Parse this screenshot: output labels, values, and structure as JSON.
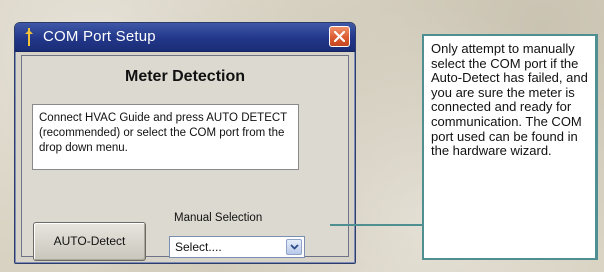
{
  "window": {
    "title": "COM Port Setup",
    "heading": "Meter Detection",
    "instructions": "Connect HVAC Guide and press AUTO DETECT (recommended) or select the COM port from the drop down menu.",
    "autodetect_label": "AUTO-Detect",
    "manual_label": "Manual Selection",
    "select_value": "Select...."
  },
  "callout": {
    "text": "Only attempt to manually select the COM port if the Auto-Detect has failed, and you are sure the meter is connected and ready for communication. The COM port used can be found in the hardware wizard."
  },
  "colors": {
    "titlebar": "#22378a",
    "close_button": "#d9582d",
    "callout_border": "#4f8f92"
  },
  "icons": {
    "title": "app-icon",
    "close": "close-icon",
    "dropdown": "chevron-down-icon"
  }
}
